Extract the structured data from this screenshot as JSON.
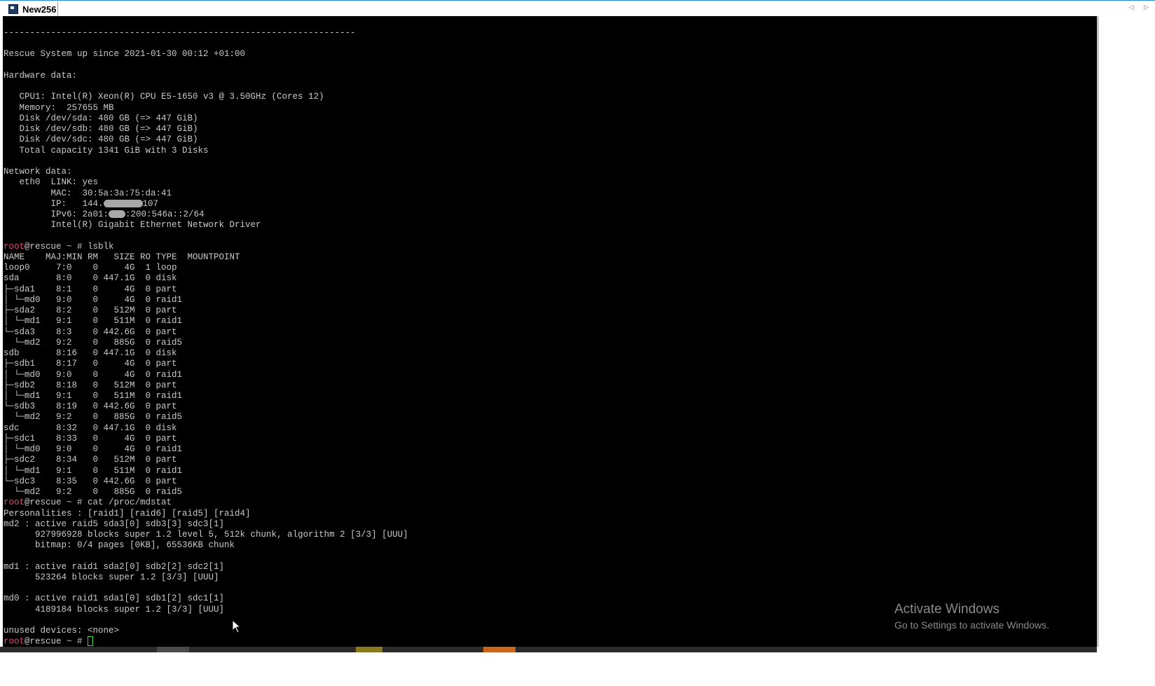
{
  "window": {
    "tab_title": "New256",
    "nav_arrows": "◁ ▷"
  },
  "terminal": {
    "lines": [
      [
        {
          "t": "-------------------------------------------------------------------"
        }
      ],
      [
        {
          "t": ""
        }
      ],
      [
        {
          "t": "Rescue System up since 2021-01-30 00:12 +01:00"
        }
      ],
      [
        {
          "t": ""
        }
      ],
      [
        {
          "t": "Hardware data:"
        }
      ],
      [
        {
          "t": ""
        }
      ],
      [
        {
          "t": "   CPU1: Intel(R) Xeon(R) CPU E5-1650 v3 @ 3.50GHz (Cores 12)"
        }
      ],
      [
        {
          "t": "   Memory:  257655 MB"
        }
      ],
      [
        {
          "t": "   Disk /dev/sda: 480 GB (=> 447 GiB)"
        }
      ],
      [
        {
          "t": "   Disk /dev/sdb: 480 GB (=> 447 GiB)"
        }
      ],
      [
        {
          "t": "   Disk /dev/sdc: 480 GB (=> 447 GiB)"
        }
      ],
      [
        {
          "t": "   Total capacity 1341 GiB with 3 Disks"
        }
      ],
      [
        {
          "t": ""
        }
      ],
      [
        {
          "t": "Network data:"
        }
      ],
      [
        {
          "t": "   eth0  LINK: yes"
        }
      ],
      [
        {
          "t": "         MAC:  30:5a:3a:75:da:41"
        }
      ],
      [
        {
          "t": "         IP:   144."
        },
        {
          "mask": 56
        },
        {
          "t": "107"
        }
      ],
      [
        {
          "t": "         IPv6: 2a01:"
        },
        {
          "mask": 24
        },
        {
          "t": ":200:546a::2/64"
        }
      ],
      [
        {
          "t": "         Intel(R) Gigabit Ethernet Network Driver"
        }
      ],
      [
        {
          "t": ""
        }
      ],
      [
        {
          "t": "root",
          "c": "u"
        },
        {
          "t": "@rescue ~ # lsblk"
        }
      ],
      [
        {
          "t": "NAME    MAJ:MIN RM   SIZE RO TYPE  MOUNTPOINT"
        }
      ],
      [
        {
          "t": "loop0     7:0    0     4G  1 loop"
        }
      ],
      [
        {
          "t": "sda       8:0    0 447.1G  0 disk"
        }
      ],
      [
        {
          "t": "├─sda1    8:1    0     4G  0 part"
        }
      ],
      [
        {
          "t": "│ └─md0   9:0    0     4G  0 raid1"
        }
      ],
      [
        {
          "t": "├─sda2    8:2    0   512M  0 part"
        }
      ],
      [
        {
          "t": "│ └─md1   9:1    0   511M  0 raid1"
        }
      ],
      [
        {
          "t": "└─sda3    8:3    0 442.6G  0 part"
        }
      ],
      [
        {
          "t": "  └─md2   9:2    0   885G  0 raid5"
        }
      ],
      [
        {
          "t": "sdb       8:16   0 447.1G  0 disk"
        }
      ],
      [
        {
          "t": "├─sdb1    8:17   0     4G  0 part"
        }
      ],
      [
        {
          "t": "│ └─md0   9:0    0     4G  0 raid1"
        }
      ],
      [
        {
          "t": "├─sdb2    8:18   0   512M  0 part"
        }
      ],
      [
        {
          "t": "│ └─md1   9:1    0   511M  0 raid1"
        }
      ],
      [
        {
          "t": "└─sdb3    8:19   0 442.6G  0 part"
        }
      ],
      [
        {
          "t": "  └─md2   9:2    0   885G  0 raid5"
        }
      ],
      [
        {
          "t": "sdc       8:32   0 447.1G  0 disk"
        }
      ],
      [
        {
          "t": "├─sdc1    8:33   0     4G  0 part"
        }
      ],
      [
        {
          "t": "│ └─md0   9:0    0     4G  0 raid1"
        }
      ],
      [
        {
          "t": "├─sdc2    8:34   0   512M  0 part"
        }
      ],
      [
        {
          "t": "│ └─md1   9:1    0   511M  0 raid1"
        }
      ],
      [
        {
          "t": "└─sdc3    8:35   0 442.6G  0 part"
        }
      ],
      [
        {
          "t": "  └─md2   9:2    0   885G  0 raid5"
        }
      ],
      [
        {
          "t": "root",
          "c": "u"
        },
        {
          "t": "@rescue ~ # cat /proc/mdstat"
        }
      ],
      [
        {
          "t": "Personalities : [raid1] [raid6] [raid5] [raid4]"
        }
      ],
      [
        {
          "t": "md2 : active raid5 sda3[0] sdb3[3] sdc3[1]"
        }
      ],
      [
        {
          "t": "      927996928 blocks super 1.2 level 5, 512k chunk, algorithm 2 [3/3] [UUU]"
        }
      ],
      [
        {
          "t": "      bitmap: 0/4 pages [0KB], 65536KB chunk"
        }
      ],
      [
        {
          "t": ""
        }
      ],
      [
        {
          "t": "md1 : active raid1 sda2[0] sdb2[2] sdc2[1]"
        }
      ],
      [
        {
          "t": "      523264 blocks super 1.2 [3/3] [UUU]"
        }
      ],
      [
        {
          "t": ""
        }
      ],
      [
        {
          "t": "md0 : active raid1 sda1[0] sdb1[2] sdc1[1]"
        }
      ],
      [
        {
          "t": "      4189184 blocks super 1.2 [3/3] [UUU]"
        }
      ],
      [
        {
          "t": ""
        }
      ],
      [
        {
          "t": "unused devices: <none>"
        }
      ],
      [
        {
          "t": "root",
          "c": "u"
        },
        {
          "t": "@rescue ~ # "
        },
        {
          "cursor": true
        }
      ]
    ]
  },
  "watermark": {
    "title": "Activate Windows",
    "subtitle": "Go to Settings to activate Windows."
  },
  "taskbar": {
    "buttons": [
      {
        "color": "#4a4a4a"
      },
      {
        "color": "#8a7a1e"
      },
      {
        "color": "#c8661e"
      }
    ]
  },
  "colors": {
    "terminal_bg": "#000000",
    "terminal_fg": "#c9c9c9",
    "user_highlight": "#e0457a",
    "cursor": "#3fdc3f"
  },
  "icons": {
    "app": "terminal-app-icon",
    "pointer": "mouse-pointer-icon"
  }
}
